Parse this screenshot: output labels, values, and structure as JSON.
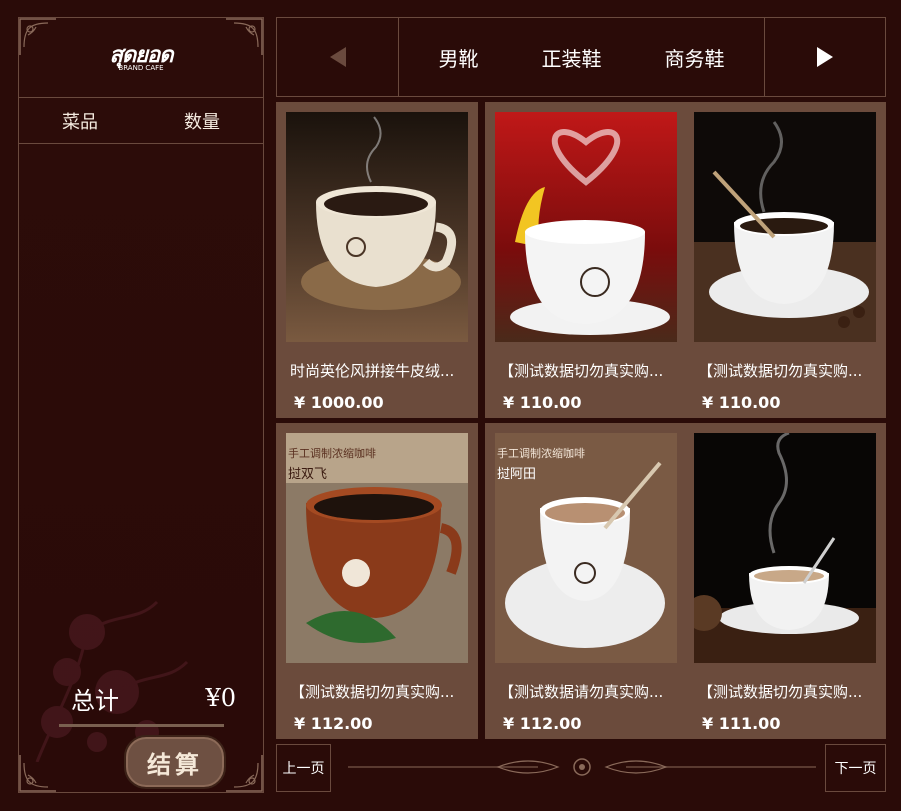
{
  "brand": {
    "logo_text": "สุดยอด",
    "logo_sub": "BRAND CAFE"
  },
  "cart": {
    "col_item": "菜品",
    "col_qty": "数量",
    "total_label": "总计",
    "total_value": "¥0",
    "checkout_label": "结算"
  },
  "nav": {
    "categories": [
      "男靴",
      "正装鞋",
      "商务鞋"
    ]
  },
  "products": [
    {
      "name": "时尚英伦风拼接牛皮绒...",
      "price": "¥ 1000.00"
    },
    {
      "name": "【测试数据切勿真实购...",
      "price": "¥ 110.00"
    },
    {
      "name": "【测试数据切勿真实购...",
      "price": "¥ 110.00"
    },
    {
      "name": "【测试数据切勿真实购...",
      "price": "¥ 112.00",
      "img_line1": "手工调制浓缩咖啡",
      "img_line2": "挝双飞"
    },
    {
      "name": "【测试数据请勿真实购...",
      "price": "¥ 112.00",
      "img_line1": "手工调制浓缩咖啡",
      "img_line2": "挝阿田"
    },
    {
      "name": "【测试数据切勿真实购...",
      "price": "¥ 111.00"
    }
  ],
  "pager": {
    "prev_label": "上一页",
    "next_label": "下一页"
  },
  "colors": {
    "background": "#2a0b08",
    "card": "#6b4b3c",
    "border": "#6a4a3e"
  }
}
